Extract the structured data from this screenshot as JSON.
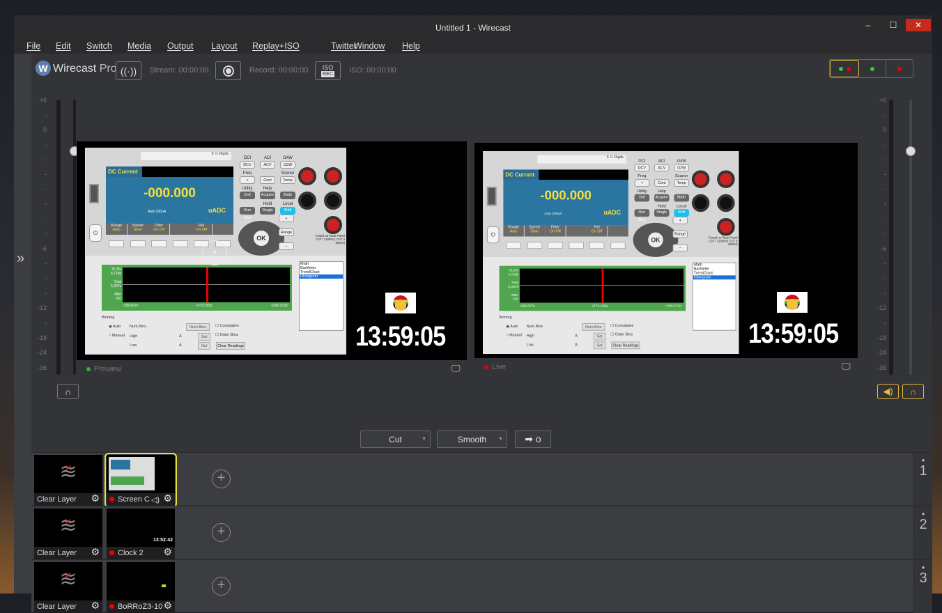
{
  "window": {
    "title": "Untitled 1 - Wirecast",
    "minimize": "–",
    "maximize": "☐",
    "close": "✕",
    "close_color": "#c42b1c"
  },
  "menu": [
    "File",
    "Edit",
    "Switch",
    "Media",
    "Output",
    "Layout",
    "Replay+ISO",
    "Twitter",
    "Window",
    "Help"
  ],
  "toolbar": {
    "brand": "Wirecast",
    "brand_suffix": "Pro",
    "stream": "Stream: 00:00:00",
    "record": "Record: 00:00:00",
    "iso_top": "ISO",
    "iso_bottom": "REC",
    "iso": "ISO: 00:00:00"
  },
  "meter_ticks": [
    "+6",
    "-",
    "0",
    "-",
    "-",
    "-",
    "-",
    "-",
    "-",
    "-",
    "-6",
    "-",
    "-",
    "-",
    "-12",
    "-",
    "-18",
    "-24",
    "-36"
  ],
  "preview": {
    "label": "Preview",
    "status_color": "#2db52d"
  },
  "live": {
    "label": "Live",
    "status_color": "#e00000"
  },
  "clock": "13:59:05",
  "multimeter": {
    "digits": "5 ½ Digits",
    "mode": "DC Current",
    "value": "-000.000",
    "range_text": "Auto 200uA",
    "unit": "uADC",
    "softkeys": [
      {
        "t": "Range",
        "v": "Auto"
      },
      {
        "t": "Speed",
        "v": "Slow"
      },
      {
        "t": "Filter",
        "v": "On  Off"
      },
      {
        "t": "",
        "v": ""
      },
      {
        "t": "Rel",
        "v": "On  Off"
      },
      {
        "t": "",
        "v": ""
      }
    ],
    "keys": [
      {
        "l": "DCI",
        "k": "DCV"
      },
      {
        "l": "ACI",
        "k": "ACV"
      },
      {
        "l": "Ω4W",
        "k": "Ω2W"
      },
      {
        "l": "Freq",
        "k": "+"
      },
      {
        "l": "",
        "k": "Cont"
      },
      {
        "l": "Scaner",
        "k": "Temp"
      },
      {
        "l": "Utility",
        "k": "2nd"
      },
      {
        "l": "Help",
        "k": "Acquire"
      },
      {
        "l": "",
        "k": "Math"
      },
      {
        "l": "",
        "k": "Run Stop"
      },
      {
        "l": "Hold",
        "k": "Single"
      },
      {
        "l": "Local",
        "k": "Shift"
      }
    ],
    "ok": "OK",
    "range_btn": "Range",
    "plus": "+",
    "minus": "–",
    "fused": "Fused on Rear Panel",
    "cat": "CAT I (1000V) CAT II (600V)",
    "chart_left": [
      "75.2%",
      "4,729k",
      "Total",
      "6,287k",
      "#Bin",
      "100"
    ],
    "chart_x": [
      "-199.627n",
      "+273.193p",
      "+200.373n"
    ],
    "list": [
      "Math",
      "BarMeter",
      "TrendChart",
      "Histogram"
    ],
    "binning": "Binning",
    "auto": "Auto",
    "manual": "Manual",
    "num_bins": "Num.Bins",
    "high": "High",
    "low": "Low",
    "num_bins_btn": "Num.Bins",
    "set": "Set",
    "cumulative": "Cumulative",
    "outer_bins": "Outer Bins",
    "clear_readings": "Clear Readings",
    "amp": "A"
  },
  "transition": {
    "cut": "Cut",
    "smooth": "Smooth",
    "go": "➡ o"
  },
  "layers": [
    {
      "num": "1",
      "shots": [
        {
          "name": "Clear Layer"
        },
        {
          "name": "Screen C",
          "live": true,
          "selected": true,
          "audio": true
        }
      ]
    },
    {
      "num": "2",
      "shots": [
        {
          "name": "Clear Layer"
        },
        {
          "name": "Clock 2",
          "live": true,
          "thumb_clock": "13:52:42"
        }
      ]
    },
    {
      "num": "3",
      "shots": [
        {
          "name": "Clear Layer"
        },
        {
          "name": "BoRRoZ3-10",
          "live": true
        }
      ]
    }
  ],
  "accent_color": "#e8b83a"
}
